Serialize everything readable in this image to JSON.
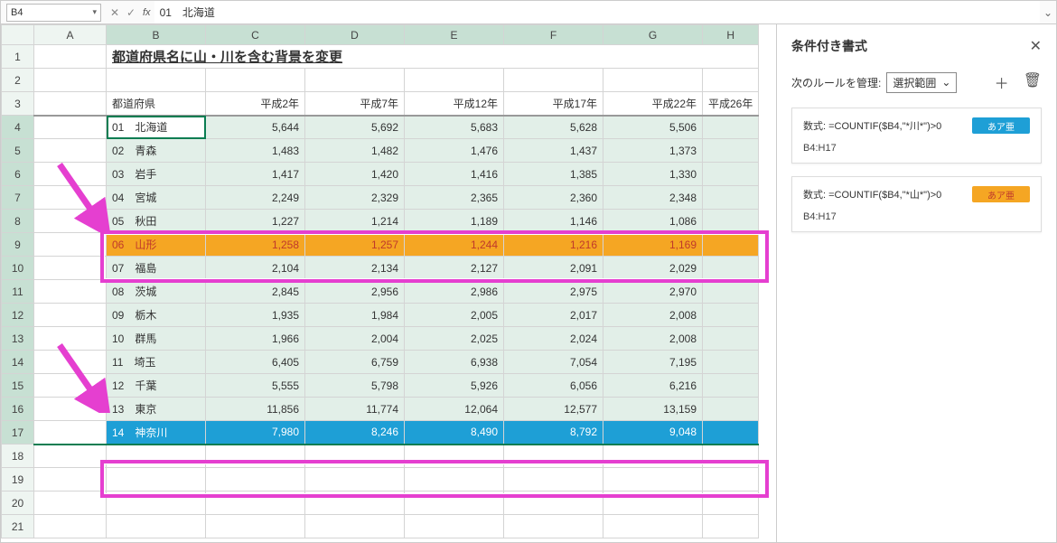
{
  "formula_bar": {
    "cell_ref": "B4",
    "value": "01　北海道"
  },
  "columns": [
    "A",
    "B",
    "C",
    "D",
    "E",
    "F",
    "G",
    "H"
  ],
  "corner": "",
  "title": "都道府県名に山・川を含む背景を変更",
  "headers": {
    "pref": "都道府県",
    "h2": "平成2年",
    "h7": "平成7年",
    "h12": "平成12年",
    "h17": "平成17年",
    "h22": "平成22年",
    "h26": "平成26年"
  },
  "rows": [
    {
      "n": 4,
      "code": "01",
      "name": "北海道",
      "vals": [
        "5,644",
        "5,692",
        "5,683",
        "5,628",
        "5,506"
      ],
      "first": true
    },
    {
      "n": 5,
      "code": "02",
      "name": "青森",
      "vals": [
        "1,483",
        "1,482",
        "1,476",
        "1,437",
        "1,373"
      ]
    },
    {
      "n": 6,
      "code": "03",
      "name": "岩手",
      "vals": [
        "1,417",
        "1,420",
        "1,416",
        "1,385",
        "1,330"
      ]
    },
    {
      "n": 7,
      "code": "04",
      "name": "宮城",
      "vals": [
        "2,249",
        "2,329",
        "2,365",
        "2,360",
        "2,348"
      ]
    },
    {
      "n": 8,
      "code": "05",
      "name": "秋田",
      "vals": [
        "1,227",
        "1,214",
        "1,189",
        "1,146",
        "1,086"
      ]
    },
    {
      "n": 9,
      "code": "06",
      "name": "山形",
      "vals": [
        "1,258",
        "1,257",
        "1,244",
        "1,216",
        "1,169"
      ],
      "hl": "orange"
    },
    {
      "n": 10,
      "code": "07",
      "name": "福島",
      "vals": [
        "2,104",
        "2,134",
        "2,127",
        "2,091",
        "2,029"
      ]
    },
    {
      "n": 11,
      "code": "08",
      "name": "茨城",
      "vals": [
        "2,845",
        "2,956",
        "2,986",
        "2,975",
        "2,970"
      ]
    },
    {
      "n": 12,
      "code": "09",
      "name": "栃木",
      "vals": [
        "1,935",
        "1,984",
        "2,005",
        "2,017",
        "2,008"
      ]
    },
    {
      "n": 13,
      "code": "10",
      "name": "群馬",
      "vals": [
        "1,966",
        "2,004",
        "2,025",
        "2,024",
        "2,008"
      ]
    },
    {
      "n": 14,
      "code": "11",
      "name": "埼玉",
      "vals": [
        "6,405",
        "6,759",
        "6,938",
        "7,054",
        "7,195"
      ]
    },
    {
      "n": 15,
      "code": "12",
      "name": "千葉",
      "vals": [
        "5,555",
        "5,798",
        "5,926",
        "6,056",
        "6,216"
      ]
    },
    {
      "n": 16,
      "code": "13",
      "name": "東京",
      "vals": [
        "11,856",
        "11,774",
        "12,064",
        "12,577",
        "13,159"
      ]
    },
    {
      "n": 17,
      "code": "14",
      "name": "神奈川",
      "vals": [
        "7,980",
        "8,246",
        "8,490",
        "8,792",
        "9,048"
      ],
      "hl": "blue",
      "last": true
    }
  ],
  "empty_rows": [
    1,
    2,
    3,
    18,
    19,
    20,
    21
  ],
  "row_1": 1,
  "row_2": 2,
  "row_3": 3,
  "row_18": 18,
  "row_19": 19,
  "row_20": 20,
  "row_21": 21,
  "panel": {
    "title": "条件付き書式",
    "manage_label": "次のルールを管理:",
    "manage_value": "選択範囲",
    "rules": [
      {
        "label": "数式:",
        "formula": "=COUNTIF($B4,\"*川*\")>0",
        "range": "B4:H17",
        "swatch": "blue",
        "swatch_text": "あア亜"
      },
      {
        "label": "数式:",
        "formula": "=COUNTIF($B4,\"*山*\")>0",
        "range": "B4:H17",
        "swatch": "orange",
        "swatch_text": "あア亜"
      }
    ]
  },
  "chart_data": {
    "type": "table",
    "title": "都道府県名に山・川を含む背景を変更",
    "columns": [
      "都道府県",
      "平成2年",
      "平成7年",
      "平成12年",
      "平成17年",
      "平成22年"
    ],
    "rows": [
      [
        "01 北海道",
        5644,
        5692,
        5683,
        5628,
        5506
      ],
      [
        "02 青森",
        1483,
        1482,
        1476,
        1437,
        1373
      ],
      [
        "03 岩手",
        1417,
        1420,
        1416,
        1385,
        1330
      ],
      [
        "04 宮城",
        2249,
        2329,
        2365,
        2360,
        2348
      ],
      [
        "05 秋田",
        1227,
        1214,
        1189,
        1146,
        1086
      ],
      [
        "06 山形",
        1258,
        1257,
        1244,
        1216,
        1169
      ],
      [
        "07 福島",
        2104,
        2134,
        2127,
        2091,
        2029
      ],
      [
        "08 茨城",
        2845,
        2956,
        2986,
        2975,
        2970
      ],
      [
        "09 栃木",
        1935,
        1984,
        2005,
        2017,
        2008
      ],
      [
        "10 群馬",
        1966,
        2004,
        2025,
        2024,
        2008
      ],
      [
        "11 埼玉",
        6405,
        6759,
        6938,
        7054,
        7195
      ],
      [
        "12 千葉",
        5555,
        5798,
        5926,
        6056,
        6216
      ],
      [
        "13 東京",
        11856,
        11774,
        12064,
        12577,
        13159
      ],
      [
        "14 神奈川",
        7980,
        8246,
        8490,
        8792,
        9048
      ]
    ]
  }
}
